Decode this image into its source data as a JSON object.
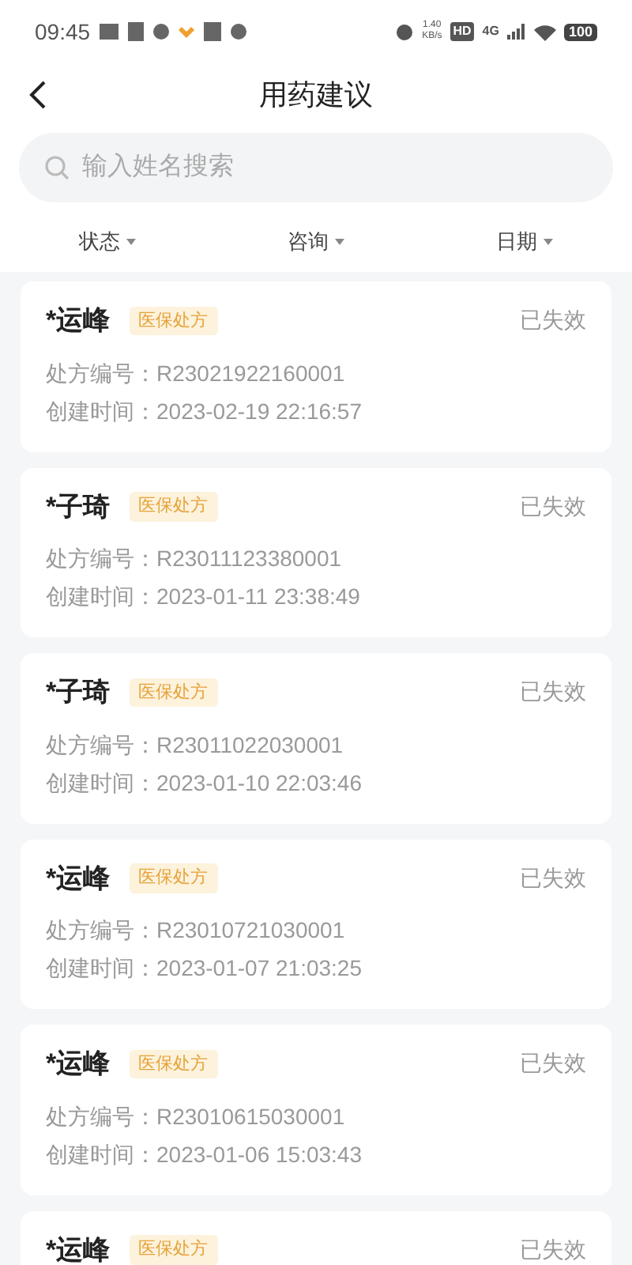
{
  "status_bar": {
    "time": "09:45",
    "net_speed": "1.40",
    "net_unit": "KB/s",
    "hd": "HD",
    "network": "4G",
    "battery": "100"
  },
  "header": {
    "title": "用药建议"
  },
  "search": {
    "placeholder": "输入姓名搜索"
  },
  "filters": [
    {
      "label": "状态"
    },
    {
      "label": "咨询"
    },
    {
      "label": "日期"
    }
  ],
  "cards": [
    {
      "name": "*运峰",
      "tag": "医保处方",
      "status": "已失效",
      "number_label": "处方编号：",
      "number": "R23021922160001",
      "time_label": "创建时间：",
      "time": "2023-02-19 22:16:57"
    },
    {
      "name": "*子琦",
      "tag": "医保处方",
      "status": "已失效",
      "number_label": "处方编号：",
      "number": "R23011123380001",
      "time_label": "创建时间：",
      "time": "2023-01-11 23:38:49"
    },
    {
      "name": "*子琦",
      "tag": "医保处方",
      "status": "已失效",
      "number_label": "处方编号：",
      "number": "R23011022030001",
      "time_label": "创建时间：",
      "time": "2023-01-10 22:03:46"
    },
    {
      "name": "*运峰",
      "tag": "医保处方",
      "status": "已失效",
      "number_label": "处方编号：",
      "number": "R23010721030001",
      "time_label": "创建时间：",
      "time": "2023-01-07 21:03:25"
    },
    {
      "name": "*运峰",
      "tag": "医保处方",
      "status": "已失效",
      "number_label": "处方编号：",
      "number": "R23010615030001",
      "time_label": "创建时间：",
      "time": "2023-01-06 15:03:43"
    },
    {
      "name": "*运峰",
      "tag": "医保处方",
      "status": "已失效"
    }
  ]
}
